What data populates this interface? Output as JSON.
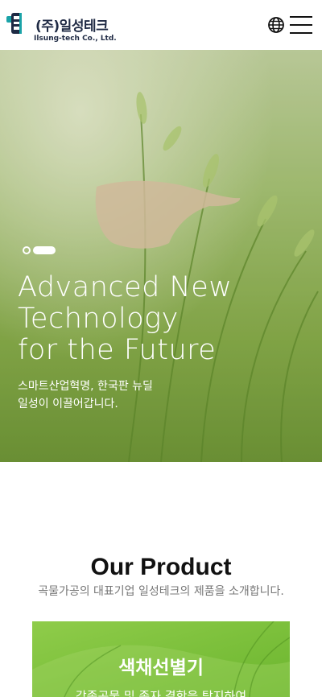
{
  "header": {
    "logo_korean": "(주)일성테크",
    "logo_english": "Ilsung-tech Co., Ltd.",
    "globe_icon": "globe-icon",
    "menu_icon": "hamburger-menu-icon"
  },
  "hero": {
    "title_lines": [
      "Advanced New",
      "Technology",
      "for the Future"
    ],
    "subtitle_lines": [
      "스마트산업혁명, 한국판 뉴딜",
      "일성이 이끌어갑니다."
    ],
    "slide_count": 2,
    "active_slide": 2
  },
  "product": {
    "title": "Our Product",
    "subtitle": "곡물가공의 대표기업 일성테크의 제품을 소개합니다.",
    "card": {
      "title": "색채선별기",
      "description": "각종곡물 및 종자 결함을 탐지하여"
    }
  },
  "colors": {
    "logo_navy": "#1f2a44",
    "logo_teal": "#1aa3a8",
    "hero_green": "#9bbf5a",
    "card_green": "#7cc23a"
  }
}
